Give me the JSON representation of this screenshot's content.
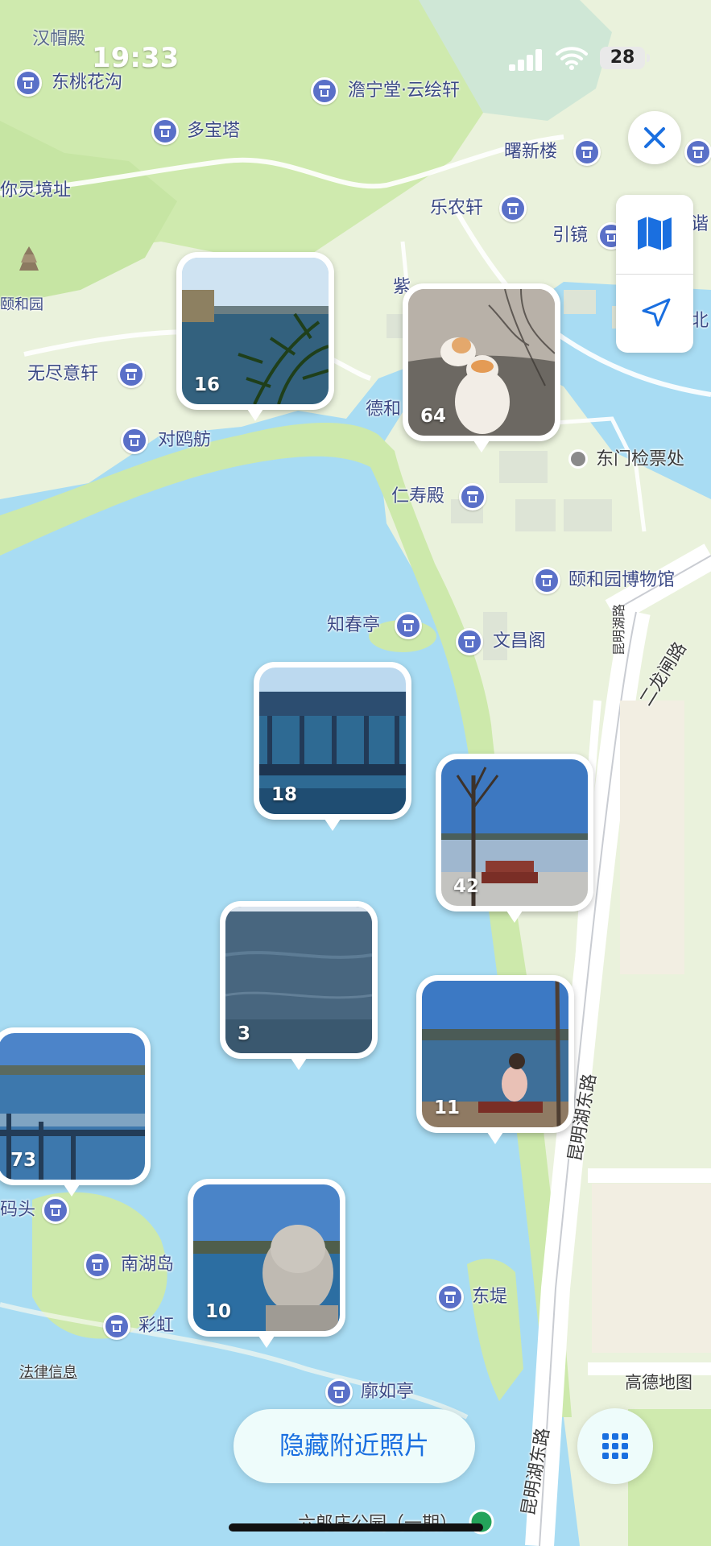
{
  "status_bar": {
    "time": "19:33",
    "battery": "28"
  },
  "map_labels": {
    "l1": "东桃花沟",
    "l2": "多宝塔",
    "l3": "你灵境址",
    "l4": "颐和园",
    "l5": "无尽意轩",
    "l6": "对鸥舫",
    "l7": "乐农轩",
    "l8": "引镜",
    "l9": "曙新楼",
    "l10": "德和",
    "l11": "东门检票处",
    "l12": "仁寿殿",
    "l13": "颐和园博物馆",
    "l14": "知春亭",
    "l15": "文昌阁",
    "l16": "二龙闸路",
    "l17": "昆明湖路",
    "l18": "昆明湖东路",
    "l19": "码头",
    "l20": "南湖岛",
    "l21": "彩虹",
    "l22": "东堤",
    "l23": "廓如亭",
    "l24": "昆明湖东路",
    "l25": "高德地图",
    "l26": "六郎庄公园（一期）",
    "l27": "北",
    "l28": "紫",
    "l29": "谐",
    "l30": "澹宁堂·云绘轩",
    "l31": "汉帽殿"
  },
  "legal_link": "法律信息",
  "clusters": [
    {
      "count": "16",
      "scene": "lake-willow"
    },
    {
      "count": "64",
      "scene": "cats"
    },
    {
      "count": "18",
      "scene": "pavilion"
    },
    {
      "count": "42",
      "scene": "bench-tree"
    },
    {
      "count": "3",
      "scene": "water"
    },
    {
      "count": "11",
      "scene": "person-lake"
    },
    {
      "count": "73",
      "scene": "railing-lake"
    },
    {
      "count": "10",
      "scene": "stone-lion"
    }
  ],
  "controls": {
    "close_icon": "close-icon",
    "map_mode_icon": "map-icon",
    "locate_icon": "location-arrow-icon",
    "hide_nearby_label": "隐藏附近照片",
    "grid_icon": "grid-icon"
  },
  "colors": {
    "water": "#a8dcf3",
    "land": "#eaf2dc",
    "park": "#cbe9a8",
    "accent": "#1a6fe0",
    "poi": "#5a70c8"
  }
}
